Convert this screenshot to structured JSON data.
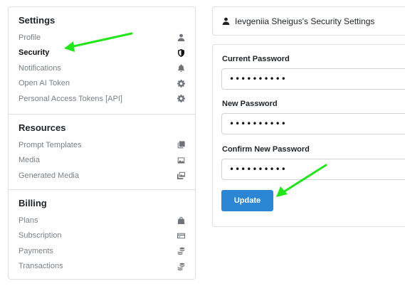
{
  "header": {
    "title": "Ievgeniia Sheigus's Security Settings"
  },
  "sidebar": {
    "sections": [
      {
        "title": "Settings",
        "items": [
          {
            "label": "Profile",
            "icon": "user-icon"
          },
          {
            "label": "Security",
            "icon": "shield-icon",
            "active": true
          },
          {
            "label": "Notifications",
            "icon": "bell-icon"
          },
          {
            "label": "Open AI Token",
            "icon": "gear-icon"
          },
          {
            "label": "Personal Access Tokens [API]",
            "icon": "gear-icon"
          }
        ]
      },
      {
        "title": "Resources",
        "items": [
          {
            "label": "Prompt Templates",
            "icon": "copy-icon"
          },
          {
            "label": "Media",
            "icon": "image-icon"
          },
          {
            "label": "Generated Media",
            "icon": "images-icon"
          }
        ]
      },
      {
        "title": "Billing",
        "items": [
          {
            "label": "Plans",
            "icon": "shopping-bag-icon"
          },
          {
            "label": "Subscription",
            "icon": "credit-card-icon"
          },
          {
            "label": "Payments",
            "icon": "coins-icon"
          },
          {
            "label": "Transactions",
            "icon": "coins-icon"
          }
        ]
      }
    ]
  },
  "form": {
    "current_password_label": "Current Password",
    "current_password_value": "••••••••••",
    "new_password_label": "New Password",
    "new_password_value": "••••••••••",
    "confirm_password_label": "Confirm New Password",
    "confirm_password_value": "••••••••••",
    "update_label": "Update"
  },
  "colors": {
    "accent": "#2b87d4",
    "annotation_arrow": "#22e61a",
    "border": "#dcdfe4"
  }
}
